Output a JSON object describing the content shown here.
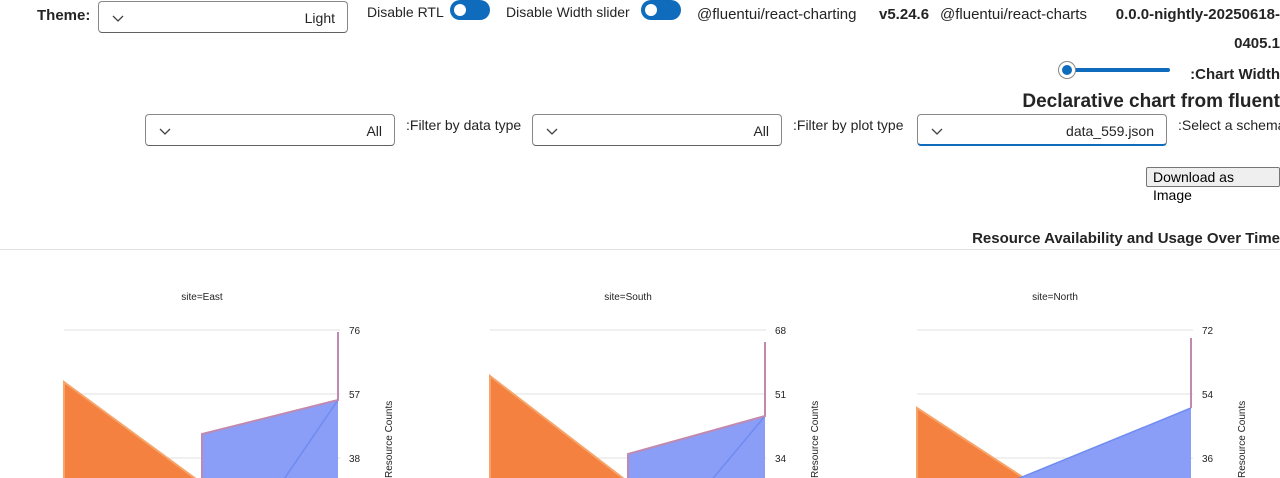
{
  "controls": {
    "theme_label": "Theme:",
    "theme_value": "Light",
    "disable_rtl_label": "Disable RTL",
    "disable_width_label": "Disable Width slider",
    "pkg_charting": "@fluentui/react-charting",
    "pkg_charting_version": "v5.24.6",
    "pkg_charts": "@fluentui/react-charts",
    "pkg_charts_version_line1": "0.0.0-nightly-20250618-",
    "pkg_charts_version_line2": "0405.1",
    "chart_width_label": ":Chart Width",
    "heading": "Declarative chart from fluent",
    "filter_data_value": "All",
    "filter_data_label": ":Filter by data type",
    "filter_plot_value": "All",
    "filter_plot_label": ":Filter by plot type",
    "schema_value": "data_559.json",
    "schema_label": ":Select a schema",
    "download_label": "Download as Image"
  },
  "colors": {
    "accent": "#0f6cbd",
    "orange": "#f4813f",
    "blue": "#8a9df7",
    "blue_line": "#6f8cf0",
    "magenta_line": "#c08ab0"
  },
  "chart_data": {
    "type": "area",
    "title": "Resource Availability and Usage Over Time",
    "ylabel": "Resource Counts",
    "panels": [
      {
        "subtitle": "site=East",
        "yticks": [
          "76",
          "57",
          "38"
        ]
      },
      {
        "subtitle": "site=South",
        "yticks": [
          "68",
          "51",
          "34"
        ]
      },
      {
        "subtitle": "site=North",
        "yticks": [
          "72",
          "54",
          "36"
        ]
      }
    ]
  }
}
